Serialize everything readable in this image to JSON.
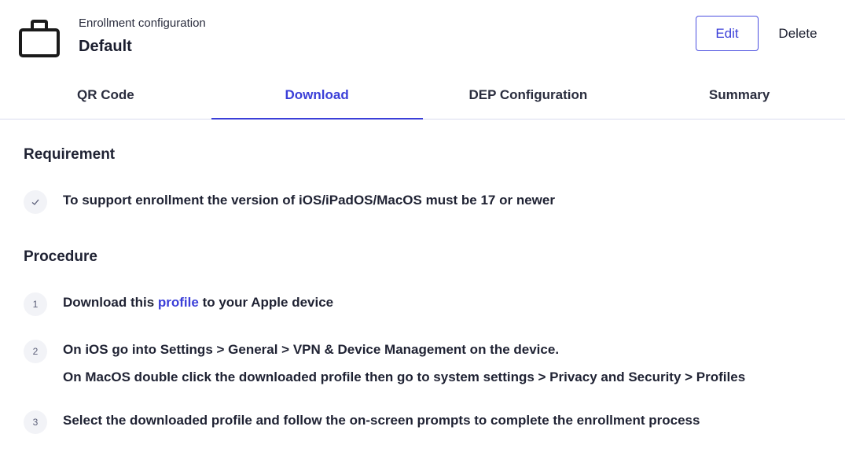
{
  "header": {
    "subtitle": "Enrollment configuration",
    "title": "Default",
    "icon": "briefcase-icon",
    "edit_label": "Edit",
    "delete_label": "Delete"
  },
  "tabs": [
    {
      "label": "QR Code",
      "active": false
    },
    {
      "label": "Download",
      "active": true
    },
    {
      "label": "DEP Configuration",
      "active": false
    },
    {
      "label": "Summary",
      "active": false
    }
  ],
  "requirement": {
    "heading": "Requirement",
    "items": [
      {
        "icon": "checkmark-icon",
        "text": "To support enrollment the version of iOS/iPadOS/MacOS must be 17 or newer"
      }
    ]
  },
  "procedure": {
    "heading": "Procedure",
    "steps": [
      {
        "number": "1",
        "before": "Download this ",
        "link": "profile",
        "after": " to your Apple device"
      },
      {
        "number": "2",
        "line1": "On iOS go into Settings > General > VPN & Device Management on the device.",
        "line2": "On MacOS double click the downloaded profile then go to system settings > Privacy and Security > Profiles"
      },
      {
        "number": "3",
        "text": "Select the downloaded profile and follow the on-screen prompts to complete the enrollment process"
      }
    ]
  },
  "colors": {
    "accent": "#3b3fd8",
    "text": "#1f2233",
    "marker_bg": "#f2f3f7"
  }
}
